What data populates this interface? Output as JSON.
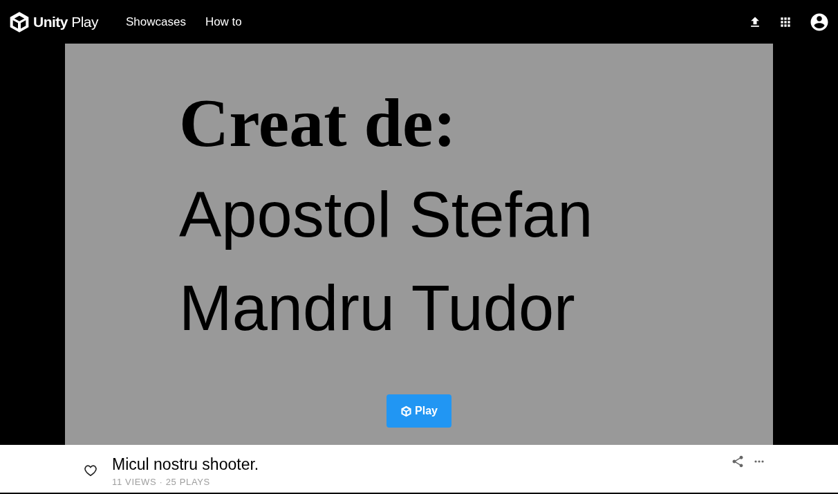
{
  "header": {
    "logo": "**Unity** Play",
    "nav": [
      {
        "label": "Showcases"
      },
      {
        "label": "How to"
      }
    ]
  },
  "game": {
    "lines": [
      {
        "text": "Creat de:",
        "kind": "serif"
      },
      {
        "text": "Apostol Stefan",
        "kind": "sans"
      },
      {
        "text": "Mandru Tudor",
        "kind": "sans"
      }
    ],
    "play_button": "Play"
  },
  "details": {
    "liked": false,
    "title": "Micul nostru shooter.",
    "stats": "11 VIEWS · 25 PLAYS"
  }
}
